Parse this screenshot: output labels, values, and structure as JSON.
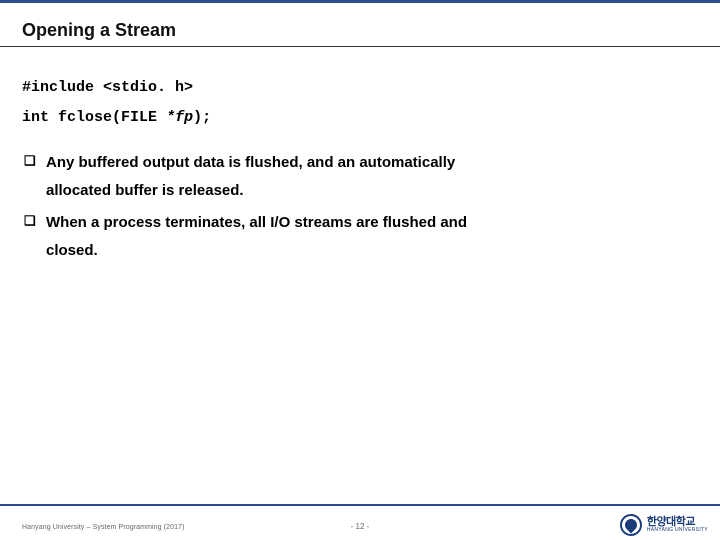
{
  "title": "Opening a Stream",
  "code": {
    "include": "#include <stdio. h>",
    "ret": "int",
    "fn": "fclose(FILE",
    "param": "*fp",
    "close": ");"
  },
  "bullets": [
    {
      "line1": "Any buffered output data is flushed, and an automatically",
      "line2": "allocated buffer is released."
    },
    {
      "line1": "When a process terminates, all I/O streams are flushed and",
      "line2": "closed."
    }
  ],
  "footer": {
    "left": "Hanyang University – System Programming (2017)",
    "center": "- 12 -",
    "logo_kr": "한양대학교",
    "logo_en": "HANYANG UNIVERSITY"
  }
}
